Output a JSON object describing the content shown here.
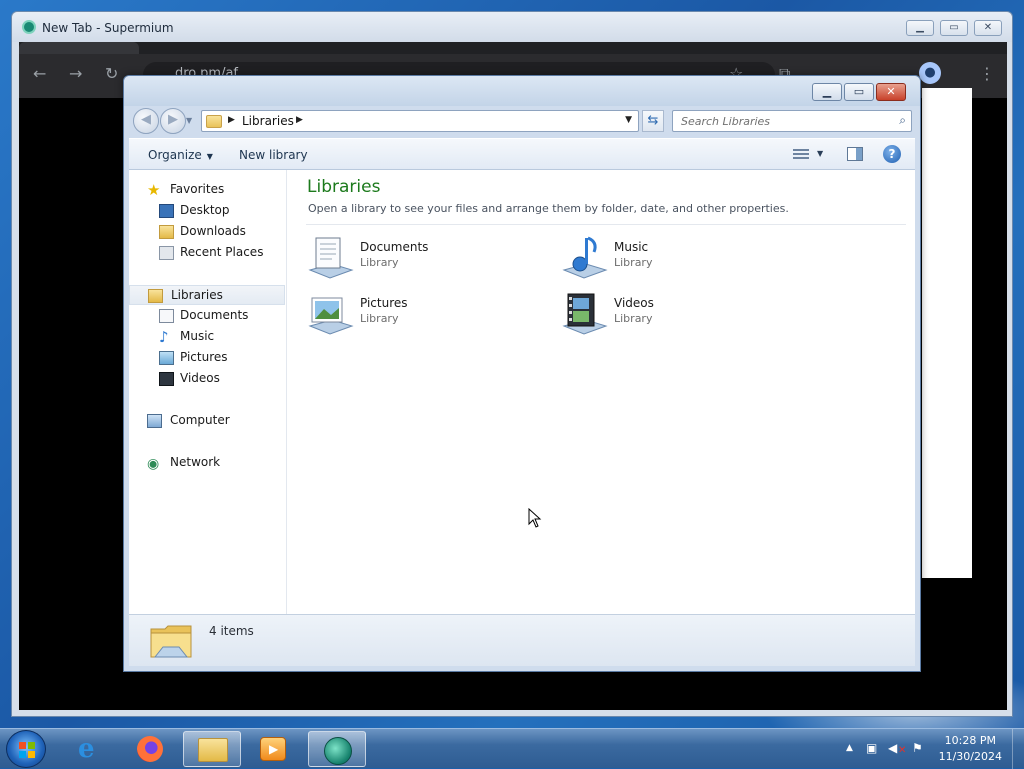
{
  "browser": {
    "title": "New Tab - Supermium",
    "url_partial": "dro.pm/af",
    "buttons": {
      "minimize": "▁",
      "maximize": "▭",
      "close": "✕"
    }
  },
  "explorer": {
    "window_buttons": {
      "minimize": "▁",
      "maximize": "▭",
      "close": "✕"
    },
    "address": {
      "crumb": "Libraries"
    },
    "search": {
      "placeholder": "Search Libraries"
    },
    "commands": {
      "organize": "Organize",
      "new_library": "New library"
    },
    "nav": {
      "favorites": "Favorites",
      "desktop": "Desktop",
      "downloads": "Downloads",
      "recent_places": "Recent Places",
      "libraries": "Libraries",
      "documents": "Documents",
      "music": "Music",
      "pictures": "Pictures",
      "videos": "Videos",
      "computer": "Computer",
      "network": "Network"
    },
    "content": {
      "title": "Libraries",
      "subtitle": "Open a library to see your files and arrange them by folder, date, and other properties.",
      "items": [
        {
          "name": "Documents",
          "type": "Library",
          "icon": "documents-library-icon"
        },
        {
          "name": "Music",
          "type": "Library",
          "icon": "music-library-icon"
        },
        {
          "name": "Pictures",
          "type": "Library",
          "icon": "pictures-library-icon"
        },
        {
          "name": "Videos",
          "type": "Library",
          "icon": "videos-library-icon"
        }
      ]
    },
    "details": {
      "count": "4 items"
    }
  },
  "taskbar": {
    "clock": {
      "time": "10:28 PM",
      "date": "11/30/2024"
    }
  }
}
